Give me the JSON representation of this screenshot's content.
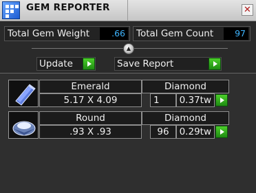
{
  "window": {
    "title": "GEM REPORTER",
    "close_glyph": "✕",
    "icon": "app-grid-icon"
  },
  "stats": {
    "weight_label": "Total Gem Weight",
    "weight_value": ".66",
    "count_label": "Total Gem Count",
    "count_value": "97"
  },
  "actions": {
    "update_label": "Update",
    "save_label": "Save Report",
    "knob_glyph": "▲"
  },
  "gems": [
    {
      "shape": "Emerald",
      "dimensions": "5.17 X 4.09",
      "type": "Diamond",
      "count": "1",
      "weight": "0.37tw",
      "icon": "emerald-cut-gem-icon"
    },
    {
      "shape": "Round",
      "dimensions": ".93 X .93",
      "type": "Diamond",
      "count": "96",
      "weight": "0.29tw",
      "icon": "round-cut-gem-icon"
    }
  ],
  "colors": {
    "value_text": "#3fb5ff",
    "go_button": "#2aa818",
    "background": "#2a2a2a"
  }
}
